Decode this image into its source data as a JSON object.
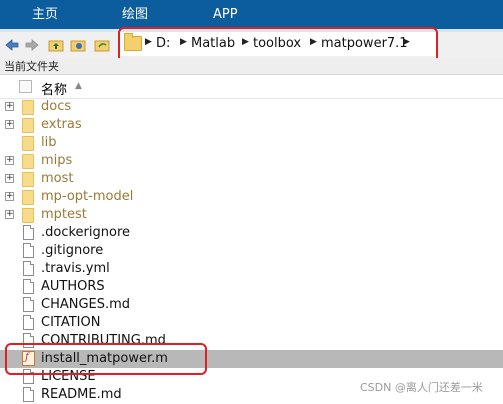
{
  "ribbon": {
    "tabs": [
      "主页",
      "绘图",
      "APP"
    ],
    "background": "#0c5d9e"
  },
  "toolbar": {
    "icons": [
      "back-arrow-icon",
      "forward-arrow-icon",
      "up-folder-icon",
      "browse-folder-icon",
      "refresh-folder-icon"
    ]
  },
  "address": {
    "crumbs": [
      "D:",
      "Matlab",
      "toolbox",
      "matpower7.1"
    ]
  },
  "panel": {
    "title": "当前文件夹"
  },
  "columns": {
    "name": "名称"
  },
  "files": [
    {
      "name": "docs",
      "type": "folder",
      "expandable": true
    },
    {
      "name": "extras",
      "type": "folder",
      "expandable": true
    },
    {
      "name": "lib",
      "type": "folder",
      "expandable": false
    },
    {
      "name": "mips",
      "type": "folder",
      "expandable": true
    },
    {
      "name": "most",
      "type": "folder",
      "expandable": true
    },
    {
      "name": "mp-opt-model",
      "type": "folder",
      "expandable": true
    },
    {
      "name": "mptest",
      "type": "folder",
      "expandable": true
    },
    {
      "name": ".dockerignore",
      "type": "file"
    },
    {
      "name": ".gitignore",
      "type": "file"
    },
    {
      "name": ".travis.yml",
      "type": "file"
    },
    {
      "name": "AUTHORS",
      "type": "file"
    },
    {
      "name": "CHANGES.md",
      "type": "file"
    },
    {
      "name": "CITATION",
      "type": "file"
    },
    {
      "name": "CONTRIBUTING.md",
      "type": "file"
    },
    {
      "name": "install_matpower.m",
      "type": "mfile",
      "selected": true
    },
    {
      "name": "LICENSE",
      "type": "file"
    },
    {
      "name": "README.md",
      "type": "file"
    }
  ],
  "watermark": "CSDN @离人门还差一米",
  "highlight_color": "#e02020"
}
